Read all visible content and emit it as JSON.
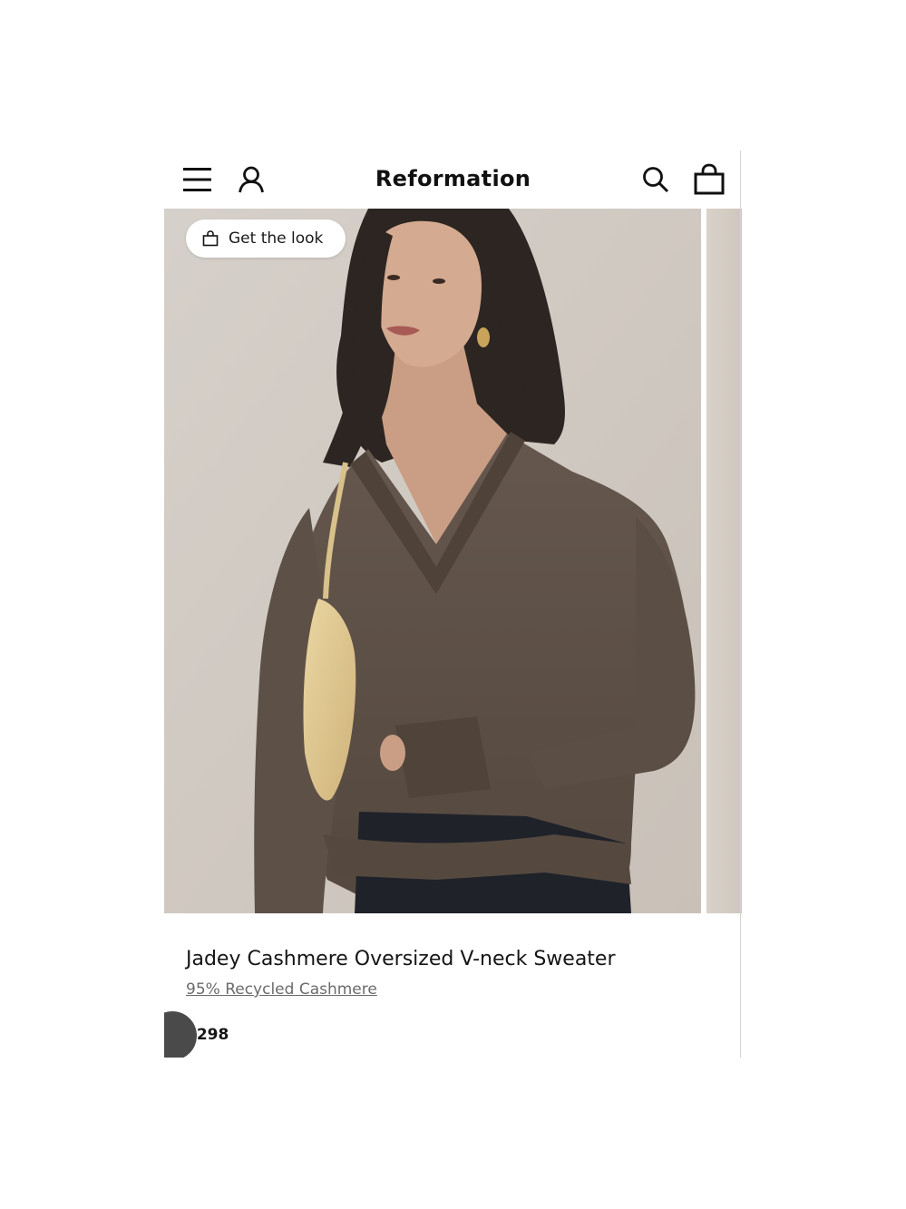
{
  "header": {
    "brand": "Reformation",
    "icons": [
      "menu-icon",
      "account-icon",
      "search-icon",
      "bag-icon"
    ]
  },
  "gallery": {
    "get_the_look_label": "Get the look",
    "get_the_look_icon": "shopping-bag-icon"
  },
  "product": {
    "title": "Jadey Cashmere Oversized V-neck Sweater",
    "material": "95% Recycled Cashmere",
    "price": "$298"
  },
  "colors": {
    "background": "#ffffff",
    "text": "#111111",
    "link": "#6b6b6b",
    "sweater": "#5e5148",
    "bag": "#e2cb94",
    "photo_backdrop": "#cfc8c0"
  }
}
